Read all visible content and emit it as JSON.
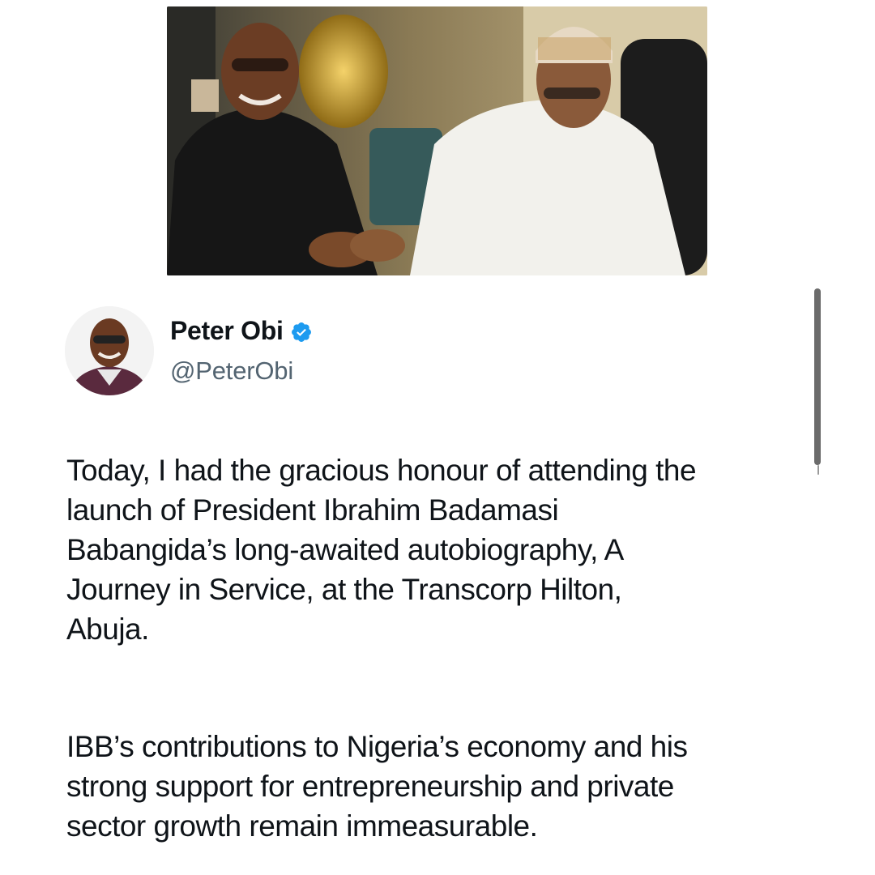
{
  "author": {
    "name": "Peter Obi",
    "handle": "@PeterObi",
    "verified": true
  },
  "tweet": {
    "paragraphs": [
      {
        "lines": [
          "Today, I had the gracious honour of attending the",
          "launch of President Ibrahim Badamasi",
          "Babangida’s long-awaited autobiography, A",
          "Journey in Service, at the Transcorp Hilton,",
          "Abuja."
        ]
      },
      {
        "lines": [
          "IBB’s contributions to Nigeria’s economy and his",
          "strong support for entrepreneurship and private",
          "sector growth remain immeasurable."
        ]
      }
    ]
  },
  "colors": {
    "text": "#0f1419",
    "secondary": "#536471",
    "verified_badge": "#1d9bf0",
    "scrollbar": "#6b6b6b"
  },
  "icons": {
    "verified": "verified-badge-icon"
  }
}
